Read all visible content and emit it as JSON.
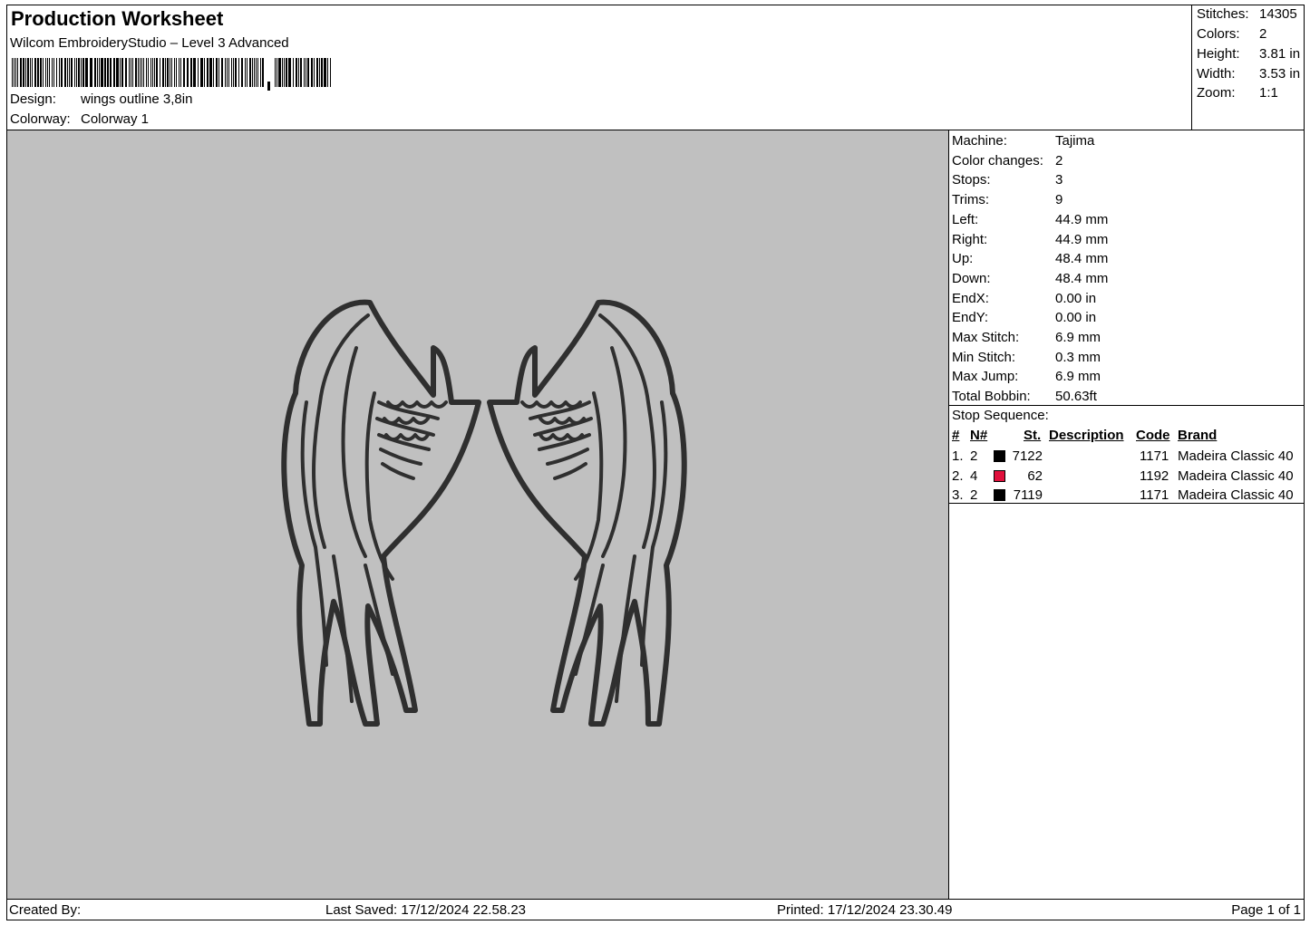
{
  "header": {
    "title": "Production Worksheet",
    "software": "Wilcom EmbroideryStudio – Level 3 Advanced",
    "design_label": "Design:",
    "design_value": "wings outline 3,8in",
    "colorway_label": "Colorway:",
    "colorway_value": "Colorway 1"
  },
  "stats": [
    {
      "label": "Stitches:",
      "value": "14305"
    },
    {
      "label": "Colors:",
      "value": "2"
    },
    {
      "label": "Height:",
      "value": "3.81 in"
    },
    {
      "label": "Width:",
      "value": "3.53 in"
    },
    {
      "label": "Zoom:",
      "value": "1:1"
    }
  ],
  "machine_info": [
    {
      "label": "Machine:",
      "value": "Tajima"
    },
    {
      "label": "Color changes:",
      "value": "2"
    },
    {
      "label": "Stops:",
      "value": "3"
    },
    {
      "label": "Trims:",
      "value": "9"
    },
    {
      "label": "Left:",
      "value": "44.9 mm"
    },
    {
      "label": "Right:",
      "value": "44.9 mm"
    },
    {
      "label": "Up:",
      "value": "48.4 mm"
    },
    {
      "label": "Down:",
      "value": "48.4 mm"
    },
    {
      "label": "EndX:",
      "value": "0.00 in"
    },
    {
      "label": "EndY:",
      "value": "0.00 in"
    },
    {
      "label": "Max Stitch:",
      "value": "6.9 mm"
    },
    {
      "label": "Min Stitch:",
      "value": "0.3 mm"
    },
    {
      "label": "Max Jump:",
      "value": "6.9 mm"
    },
    {
      "label": "Total Bobbin:",
      "value": "50.63ft"
    }
  ],
  "stop_sequence": {
    "title": "Stop Sequence:",
    "headers": {
      "num": "#",
      "n": "N#",
      "st": "St.",
      "desc": "Description",
      "code": "Code",
      "brand": "Brand"
    },
    "rows": [
      {
        "num": "1.",
        "n": "2",
        "color": "#000000",
        "st": "7122",
        "desc": "",
        "code": "1171",
        "brand": "Madeira Classic 40"
      },
      {
        "num": "2.",
        "n": "4",
        "color": "#e0103c",
        "st": "62",
        "desc": "",
        "code": "1192",
        "brand": "Madeira Classic 40"
      },
      {
        "num": "3.",
        "n": "2",
        "color": "#000000",
        "st": "7119",
        "desc": "",
        "code": "1171",
        "brand": "Madeira Classic 40"
      }
    ]
  },
  "canvas": {
    "background": "#c0c0c0",
    "stroke_color": "#2f2f2f",
    "fill_color": "#c0c0c0"
  },
  "footer": {
    "created_by": "Created By:",
    "last_saved": "Last Saved: 17/12/2024 22.58.23",
    "printed": "Printed: 17/12/2024 23.30.49",
    "page": "Page 1 of 1"
  }
}
